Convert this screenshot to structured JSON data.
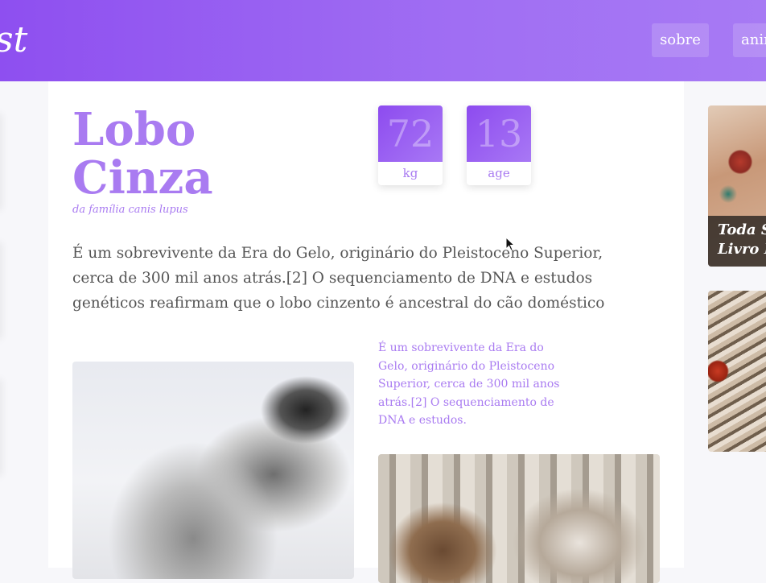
{
  "header": {
    "logo": "st",
    "nav": [
      {
        "label": "sobre"
      },
      {
        "label": "animais"
      }
    ]
  },
  "article": {
    "title_line1": "Lobo",
    "title_line2": "Cinza",
    "subtitle": "da família canis lupus",
    "stats": [
      {
        "value": "72",
        "unit": "kg"
      },
      {
        "value": "13",
        "unit": "age"
      }
    ],
    "intro": "É um sobrevivente da Era do Gelo, originário do Pleistoceno Superior, cerca de 300 mil anos atrás.[2] O sequenciamento de DNA e estudos genéticos reafirmam que o lobo cinzento é ancestral do cão doméstico",
    "side_note": "É um sobrevivente da Era do Gelo, originário do Pleistoceno Superior, cerca de 300 mil anos atrás.[2] O sequenciamento de DNA e estudos."
  },
  "sidebar": {
    "cards": [
      {
        "caption_line1": "Toda S",
        "caption_line2": "Livro I"
      },
      {
        "caption_line1": "",
        "caption_line2": ""
      }
    ]
  },
  "colors": {
    "accent": "#a97bf1",
    "header_start": "#8e4ff0",
    "header_end": "#a77af4"
  }
}
